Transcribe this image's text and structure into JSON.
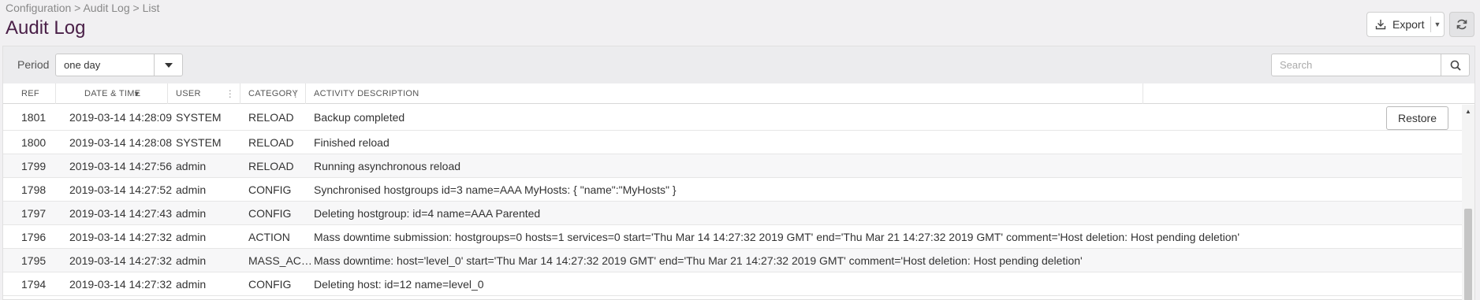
{
  "breadcrumb": "Configuration > Audit Log > List",
  "page_title": "Audit Log",
  "export_label": "Export",
  "period": {
    "label": "Period",
    "value": "one day"
  },
  "search": {
    "placeholder": "Search",
    "value": ""
  },
  "columns": {
    "ref": "REF",
    "datetime": "DATE & TIME",
    "user": "USER",
    "category": "CATEGORY",
    "activity": "ACTIVITY DESCRIPTION"
  },
  "restore_label": "Restore",
  "rows": [
    {
      "ref": "1801",
      "datetime": "2019-03-14 14:28:09",
      "user": "SYSTEM",
      "category": "RELOAD",
      "activity": "Backup completed"
    },
    {
      "ref": "1800",
      "datetime": "2019-03-14 14:28:08",
      "user": "SYSTEM",
      "category": "RELOAD",
      "activity": "Finished reload"
    },
    {
      "ref": "1799",
      "datetime": "2019-03-14 14:27:56",
      "user": "admin",
      "category": "RELOAD",
      "activity": "Running asynchronous reload"
    },
    {
      "ref": "1798",
      "datetime": "2019-03-14 14:27:52",
      "user": "admin",
      "category": "CONFIG",
      "activity": "Synchronised hostgroups id=3 name=AAA MyHosts: { \"name\":\"MyHosts\" }"
    },
    {
      "ref": "1797",
      "datetime": "2019-03-14 14:27:43",
      "user": "admin",
      "category": "CONFIG",
      "activity": "Deleting hostgroup: id=4 name=AAA Parented"
    },
    {
      "ref": "1796",
      "datetime": "2019-03-14 14:27:32",
      "user": "admin",
      "category": "ACTION",
      "activity": "Mass downtime submission: hostgroups=0 hosts=1 services=0 start='Thu Mar 14 14:27:32 2019 GMT' end='Thu Mar 21 14:27:32 2019 GMT' comment='Host deletion: Host pending deletion'"
    },
    {
      "ref": "1795",
      "datetime": "2019-03-14 14:27:32",
      "user": "admin",
      "category": "MASS_AC…",
      "activity": "Mass downtime: host='level_0' start='Thu Mar 14 14:27:32 2019 GMT' end='Thu Mar 21 14:27:32 2019 GMT' comment='Host deletion: Host pending deletion'"
    },
    {
      "ref": "1794",
      "datetime": "2019-03-14 14:27:32",
      "user": "admin",
      "category": "CONFIG",
      "activity": "Deleting host: id=12 name=level_0"
    }
  ],
  "icons": {
    "export": "download-icon",
    "refresh": "refresh-icon",
    "dropdown": "caret-down-icon",
    "search": "search-icon",
    "sort": "sort-desc-icon",
    "column_menu": "column-menu-icon"
  }
}
